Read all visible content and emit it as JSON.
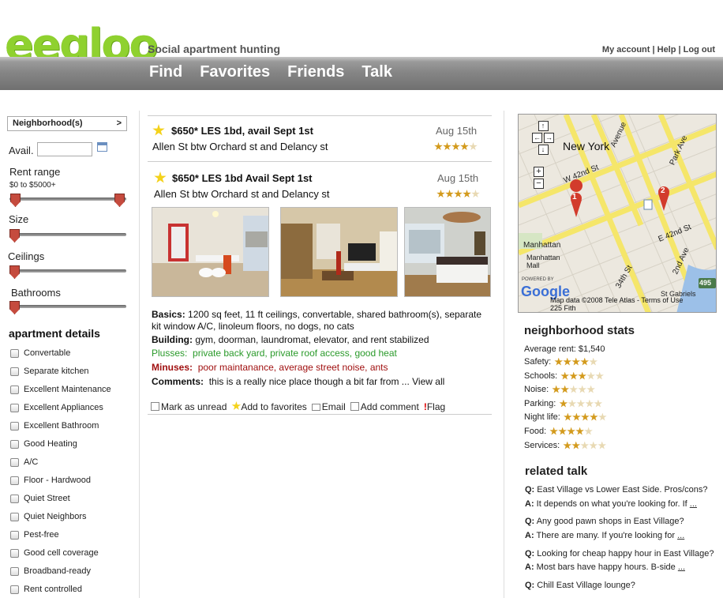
{
  "brand": {
    "logo": "eegloo",
    "tagline": "Social apartment hunting",
    "accent": "#8fd12f"
  },
  "top_links": [
    "My account",
    "Help",
    "Log out"
  ],
  "nav": [
    "Find",
    "Favorites",
    "Friends",
    "Talk"
  ],
  "sidebar": {
    "neighborhood_label": "Neighborhood(s)",
    "neighborhood_arrow": ">",
    "avail_label": "Avail.",
    "avail_value": "",
    "rent_label": "Rent range",
    "rent_value": "$0 to $5000+",
    "size_label": "Size",
    "ceilings_label": "Ceilings",
    "bathrooms_label": "Bathrooms",
    "details_heading": "apartment details",
    "details": [
      "Convertable",
      "Separate kitchen",
      "Excellent Maintenance",
      "Excellent Appliances",
      "Excellent Bathroom",
      "Good Heating",
      "A/C",
      "Floor - Hardwood",
      "Quiet Street",
      "Quiet Neighbors",
      "Pest-free",
      "Good cell coverage",
      "Broadband-ready",
      "Rent controlled"
    ]
  },
  "listings": [
    {
      "title": "$650* LES 1bd, avail Sept 1st",
      "address": "Allen St btw Orchard st and Delancy st",
      "date": "Aug 15th",
      "rating": 4
    },
    {
      "title": "$650* LES 1bd Avail Sept 1st",
      "address": "Allen St btw Orchard st and Delancy st",
      "date": "Aug 15th",
      "rating": 4
    }
  ],
  "detail": {
    "basics_label": "Basics:",
    "basics": "1200 sq feet, 11 ft ceilings, convertable, shared bathroom(s), separate kit window A/C, linoleum floors, no dogs, no cats",
    "building_label": "Building:",
    "building": "gym, doorman, laundromat, elevator, and rent stabilized",
    "plusses_label": "Plusses:",
    "plusses": "private back yard, private roof access, good heat",
    "minuses_label": "Minuses:",
    "minuses": "poor maintanance, average street noise, ants",
    "comments_label": "Comments:",
    "comments": "this is a really nice place though a bit far from ... View all"
  },
  "actions": [
    "Mark as unread",
    "Add to favorites",
    "Email",
    "Add comment",
    "Flag"
  ],
  "map": {
    "city": "New York",
    "labels": [
      "Manhattan",
      "Manhattan Mall",
      "W 42nd St",
      "E 42nd St",
      "Park Ave",
      "2nd Ave",
      "34th St",
      "Avenue",
      "St Gabriels"
    ],
    "markers": [
      "1",
      "2"
    ],
    "powered_by": "POWERED BY",
    "google": "Google",
    "copyright": "Map data ©2008 Tele Atlas - Terms of Use",
    "scale": "225 Fith",
    "highway": "495"
  },
  "neighborhood_stats": {
    "heading": "neighborhood stats",
    "avg_rent": "Average rent: $1,540",
    "items": [
      {
        "label": "Safety:",
        "rating": 4
      },
      {
        "label": "Schools:",
        "rating": 3
      },
      {
        "label": "Noise:",
        "rating": 2
      },
      {
        "label": "Parking:",
        "rating": 1
      },
      {
        "label": "Night life:",
        "rating": 4
      },
      {
        "label": "Food:",
        "rating": 4
      },
      {
        "label": "Services:",
        "rating": 2
      }
    ]
  },
  "related_talk": {
    "heading": "related talk",
    "items": [
      {
        "q": "East Village vs Lower East Side. Pros/cons?",
        "a": "It depends on what you're looking for. If",
        "more": "..."
      },
      {
        "q": "Any good pawn shops in East Village?",
        "a": "There are many. If you're looking for",
        "more": "..."
      },
      {
        "q": "Looking for cheap happy hour in East Village?",
        "a": "Most bars have happy hours. B-side",
        "more": "..."
      },
      {
        "q": "Chill East Village lounge?",
        "a": "",
        "more": ""
      }
    ],
    "q_prefix": "Q:",
    "a_prefix": "A:"
  }
}
